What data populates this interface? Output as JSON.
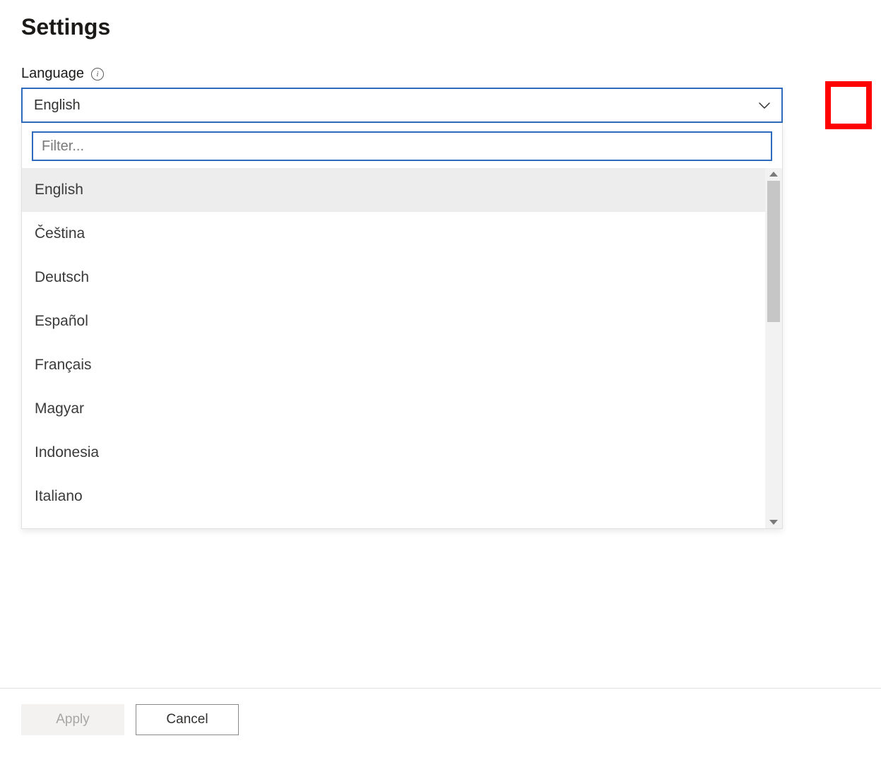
{
  "page": {
    "title": "Settings"
  },
  "language": {
    "label": "Language",
    "selected": "English",
    "filter_placeholder": "Filter...",
    "options": [
      "English",
      "Čeština",
      "Deutsch",
      "Español",
      "Français",
      "Magyar",
      "Indonesia",
      "Italiano"
    ]
  },
  "footer": {
    "apply_label": "Apply",
    "cancel_label": "Cancel"
  }
}
